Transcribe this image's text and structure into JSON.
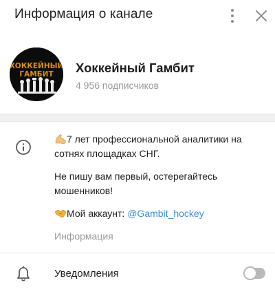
{
  "header": {
    "title": "Информация о канале",
    "more_icon": "more-vertical-icon",
    "close_icon": "close-icon"
  },
  "channel": {
    "name": "Хоккейный Гамбит",
    "subscribers": "4 956 подписчиков",
    "avatar_logo_text": [
      "ХОККЕЙНЫЙ",
      "ГАМБИТ"
    ]
  },
  "description": {
    "line1_emoji": "flexed-biceps-emoji",
    "line1": "7 лет профессиональной аналитики на сотнях площадках СНГ.",
    "line2": "Не пишу вам первый, остерегайтесь мошенников!",
    "line3_emoji": "handshake-emoji",
    "line3_prefix": "Мой аккаунт: ",
    "line3_handle": "@Gambit_hockey",
    "caption": "Информация"
  },
  "notifications": {
    "label": "Уведомления",
    "enabled": false
  },
  "colors": {
    "accent": "#3a8fd0",
    "secondary_text": "#9a9a9a",
    "toggle_off": "#b9b9b9",
    "avatar_text": "#d89a1e"
  }
}
